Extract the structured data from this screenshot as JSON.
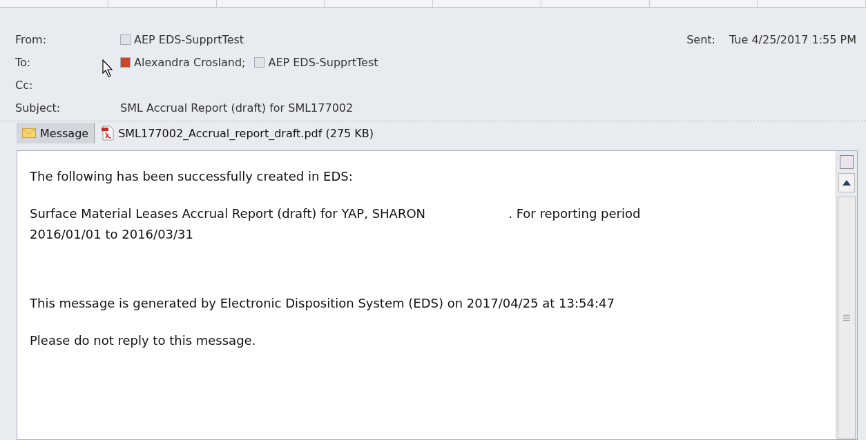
{
  "header": {
    "from_label": "From:",
    "from": [
      {
        "name": "AEP EDS-SupprtTest",
        "color": "#dfe3e6"
      }
    ],
    "to_label": "To:",
    "to": [
      {
        "name": "Alexandra Crosland;",
        "color": "#c8462c"
      },
      {
        "name": "AEP EDS-SupprtTest",
        "color": "#dfe3e6"
      }
    ],
    "cc_label": "Cc:",
    "subject_label": "Subject:",
    "subject": "SML Accrual Report (draft) for SML177002",
    "sent_label": "Sent:",
    "sent": "Tue 4/25/2017 1:55 PM"
  },
  "attachments": [
    {
      "kind": "message",
      "label": "Message",
      "selected": true
    },
    {
      "kind": "pdf",
      "label": "SML177002_Accrual_report_draft.pdf (275 KB)",
      "selected": false
    }
  ],
  "body": [
    "The following has been successfully created in EDS:",
    "Surface Material Leases Accrual Report (draft) for YAP, SHARON                     . For reporting period 2016/01/01 to 2016/03/31",
    "This message is generated by Electronic Disposition System (EDS) on 2017/04/25 at 13:54:47",
    "Please do not reply to this message."
  ]
}
